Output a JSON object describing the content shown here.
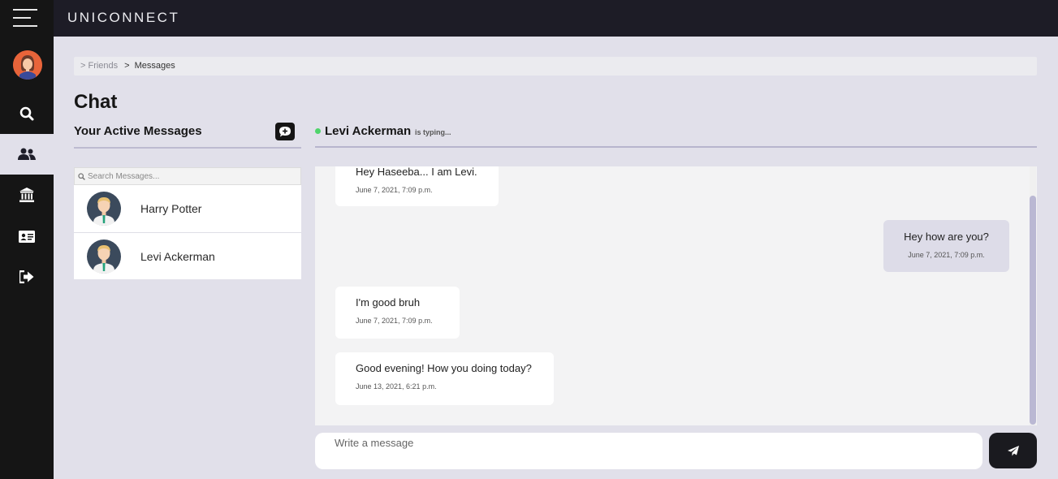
{
  "app": {
    "brand": "UNICONNECT"
  },
  "sidebar": {
    "items": [
      {
        "icon": "search-icon"
      },
      {
        "icon": "users-icon",
        "active": true
      },
      {
        "icon": "bank-icon"
      },
      {
        "icon": "id-card-icon"
      },
      {
        "icon": "logout-icon"
      }
    ]
  },
  "breadcrumb": {
    "prefix": "> Friends",
    "separator": ">",
    "current": "Messages"
  },
  "page": {
    "title": "Chat"
  },
  "left_panel": {
    "title": "Your Active Messages",
    "search_placeholder": "Search Messages...",
    "friends": [
      {
        "name": "Harry Potter"
      },
      {
        "name": "Levi Ackerman"
      }
    ]
  },
  "chat": {
    "contact_name": "Levi Ackerman",
    "status": "is typing...",
    "messages": [
      {
        "text": "Hey Haseeba... I am Levi.",
        "time": "June 7, 2021, 7:09 p.m.",
        "mine": false
      },
      {
        "text": "Hey how are you?",
        "time": "June 7, 2021, 7:09 p.m.",
        "mine": true
      },
      {
        "text": "I'm good bruh",
        "time": "June 7, 2021, 7:09 p.m.",
        "mine": false
      },
      {
        "text": "Good evening! How you doing today?",
        "time": "June 13, 2021, 6:21 p.m.",
        "mine": false
      }
    ],
    "composer_placeholder": "Write a message"
  },
  "colors": {
    "sidebar": "#151515",
    "topbar": "#1d1c26",
    "background": "#e1e0ea",
    "accent": "#bab8d3",
    "online": "#4fd46b"
  }
}
